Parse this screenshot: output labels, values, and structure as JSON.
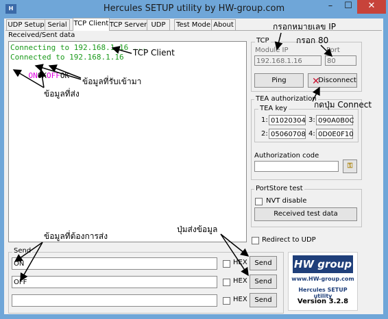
{
  "window": {
    "title": "Hercules SETUP utility by HW-group.com",
    "minimize": "–",
    "maximize": "☐",
    "close": "✕"
  },
  "tabs": [
    "UDP Setup",
    "Serial",
    "TCP Client",
    "TCP Server",
    "UDP",
    "Test Mode",
    "About"
  ],
  "active_tab": "TCP Client",
  "received": {
    "label": "Received/Sent data",
    "lines": [
      "Connecting to 192.168.1.16 ...",
      "Connected to 192.168.1.16"
    ],
    "exchange": [
      {
        "text": "ON",
        "color": "#e000e0"
      },
      {
        "text": "OK",
        "color": "#000000"
      },
      {
        "text": "OFF",
        "color": "#e000e0"
      },
      {
        "text": "OK",
        "color": "#000000"
      }
    ]
  },
  "tcp": {
    "legend": "TCP",
    "module_ip_label": "Module IP",
    "port_label": "Port",
    "module_ip": "192.168.1.16",
    "port": "80",
    "ping": "Ping",
    "disconnect": "Disconnect"
  },
  "tea": {
    "legend": "TEA authorization",
    "key_legend": "TEA key",
    "keys": [
      {
        "n": "1:",
        "v": "01020304"
      },
      {
        "n": "3:",
        "v": "090A0B0C"
      },
      {
        "n": "2:",
        "v": "05060708"
      },
      {
        "n": "4:",
        "v": "0D0E0F10"
      }
    ],
    "auth_code_label": "Authorization code",
    "auth_code": ""
  },
  "portstore": {
    "legend": "PortStore test",
    "nvt_disable": "NVT disable",
    "received_test_data": "Received test data"
  },
  "redirect_udp": "Redirect to UDP",
  "send": {
    "legend": "Send",
    "rows": [
      {
        "value": "ON",
        "hex": "HEX",
        "button": "Send"
      },
      {
        "value": "OFF",
        "hex": "HEX",
        "button": "Send"
      },
      {
        "value": "",
        "hex": "HEX",
        "button": "Send"
      }
    ]
  },
  "logo": {
    "brand": "HW group",
    "url": "www.HW-group.com",
    "product": "Hercules SETUP utility",
    "version": "Version  3.2.8"
  },
  "annotations": {
    "ip": "กรอกหมายเลข IP",
    "port": "กรอก 80",
    "tcp_client": "TCP Client",
    "received": "ข้อมูลที่รับเข้ามา",
    "sent": "ข้อมูลที่ส่ง",
    "connect": "กดปุ่ม Connect",
    "to_send": "ข้อมูลที่ต้องการส่ง",
    "send_button": "ปุ่มส่งข้อมูล"
  }
}
